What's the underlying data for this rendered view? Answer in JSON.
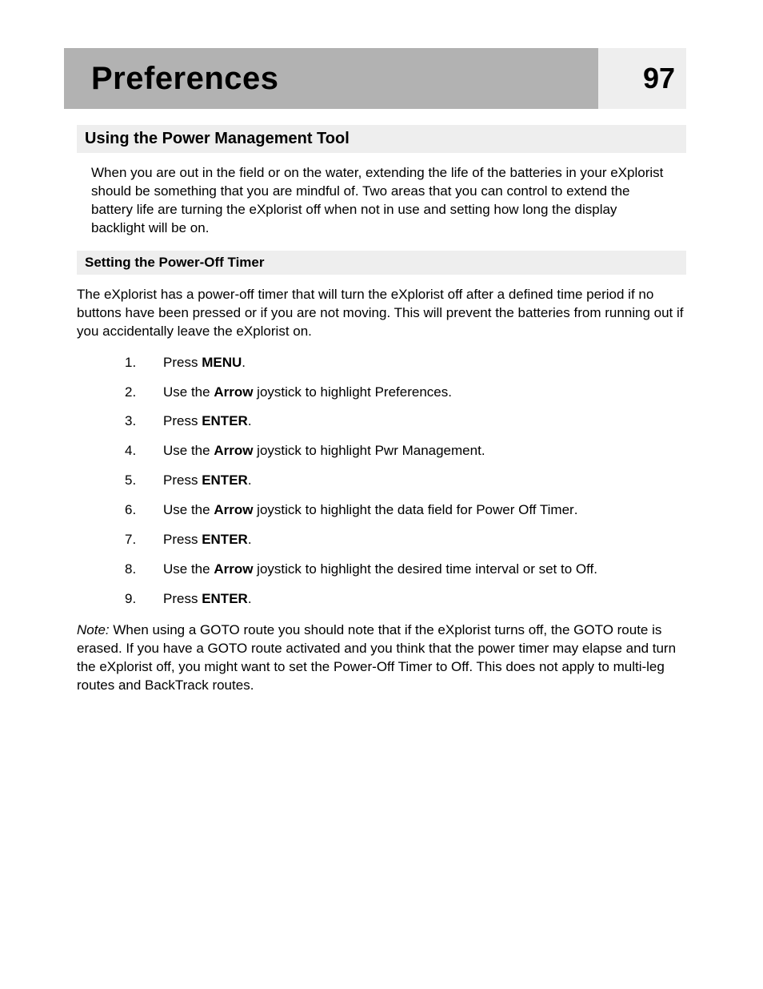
{
  "header": {
    "title": "Preferences",
    "page_number": "97"
  },
  "section": {
    "heading": "Using the Power Management Tool",
    "intro": "When you are out in the field or on the water, extending the life of the batteries in your eXplorist should be something that you are mindful of.  Two areas that you can control to extend the battery life are turning the eXplorist off when not in use and setting how long the display backlight will be on."
  },
  "subsection": {
    "heading": "Setting the Power-Off Timer",
    "intro": "The eXplorist has a power-off timer that will turn the eXplorist off after a defined time period if no buttons have been pressed or if you are not moving.  This will prevent the batteries from running out if you accidentally leave the eXplorist on.",
    "steps": [
      {
        "pre": "Press ",
        "bold": "MENU",
        "post": "."
      },
      {
        "pre": "Use the ",
        "bold": "Arrow",
        "mid": " joystick to highlight ",
        "menu": "Preferences",
        "post": "."
      },
      {
        "pre": "Press ",
        "bold": "ENTER",
        "post": "."
      },
      {
        "pre": "Use the ",
        "bold": "Arrow",
        "mid": " joystick to highlight ",
        "menu": "Pwr Management",
        "post": "."
      },
      {
        "pre": "Press ",
        "bold": "ENTER",
        "post": "."
      },
      {
        "pre": "Use the ",
        "bold": "Arrow",
        "mid": " joystick to highlight the data field for ",
        "menu": "Power Off Timer",
        "post": "."
      },
      {
        "pre": "Press ",
        "bold": "ENTER",
        "post": "."
      },
      {
        "pre": "Use the ",
        "bold": "Arrow",
        "mid": " joystick to highlight the desired time interval or set to ",
        "menu": "Off",
        "post": "."
      },
      {
        "pre": "Press ",
        "bold": "ENTER",
        "post": "."
      }
    ],
    "note": {
      "label": "Note:",
      "pre": "  When using a GOTO route you should note that if the eXplorist turns off, the GOTO route is erased.  If you have a GOTO route activated and you think that the power timer may elapse and turn the eXplorist off, you might want to set the Power-Off Timer to ",
      "menu": "Off",
      "post": ".  This does not apply to multi-leg routes and BackTrack routes."
    }
  }
}
